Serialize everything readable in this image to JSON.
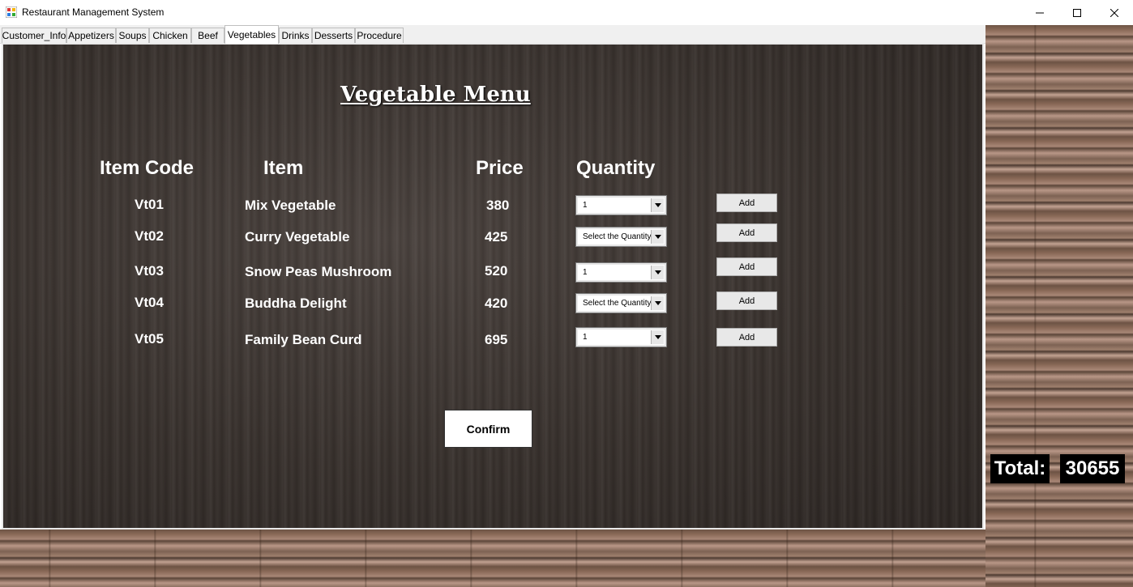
{
  "window": {
    "title": "Restaurant Management System",
    "controls": {
      "minimize": "—",
      "maximize": "☐",
      "close": "✕"
    }
  },
  "tabs": [
    {
      "label": "Customer_Info"
    },
    {
      "label": "Appetizers"
    },
    {
      "label": "Soups"
    },
    {
      "label": "Chicken"
    },
    {
      "label": "Beef"
    },
    {
      "label": "Vegetables",
      "active": true
    },
    {
      "label": "Drinks"
    },
    {
      "label": "Desserts"
    },
    {
      "label": "Procedure"
    }
  ],
  "menu": {
    "title": "Vegetable Menu",
    "headers": {
      "code": "Item Code",
      "item": "Item",
      "price": "Price",
      "quantity": "Quantity"
    },
    "add_label": "Add",
    "rows": [
      {
        "code": "Vt01",
        "item": "Mix Vegetable",
        "price": "380",
        "quantity": "1"
      },
      {
        "code": "Vt02",
        "item": "Curry Vegetable",
        "price": "425",
        "quantity": "Select the Quantity"
      },
      {
        "code": "Vt03",
        "item": "Snow Peas Mushroom",
        "price": "520",
        "quantity": "1"
      },
      {
        "code": "Vt04",
        "item": "Buddha Delight",
        "price": "420",
        "quantity": "Select the Quantity"
      },
      {
        "code": "Vt05",
        "item": "Family Bean Curd",
        "price": "695",
        "quantity": "1"
      }
    ],
    "confirm_label": "Confirm"
  },
  "total": {
    "label": "Total:",
    "value": "30655"
  }
}
